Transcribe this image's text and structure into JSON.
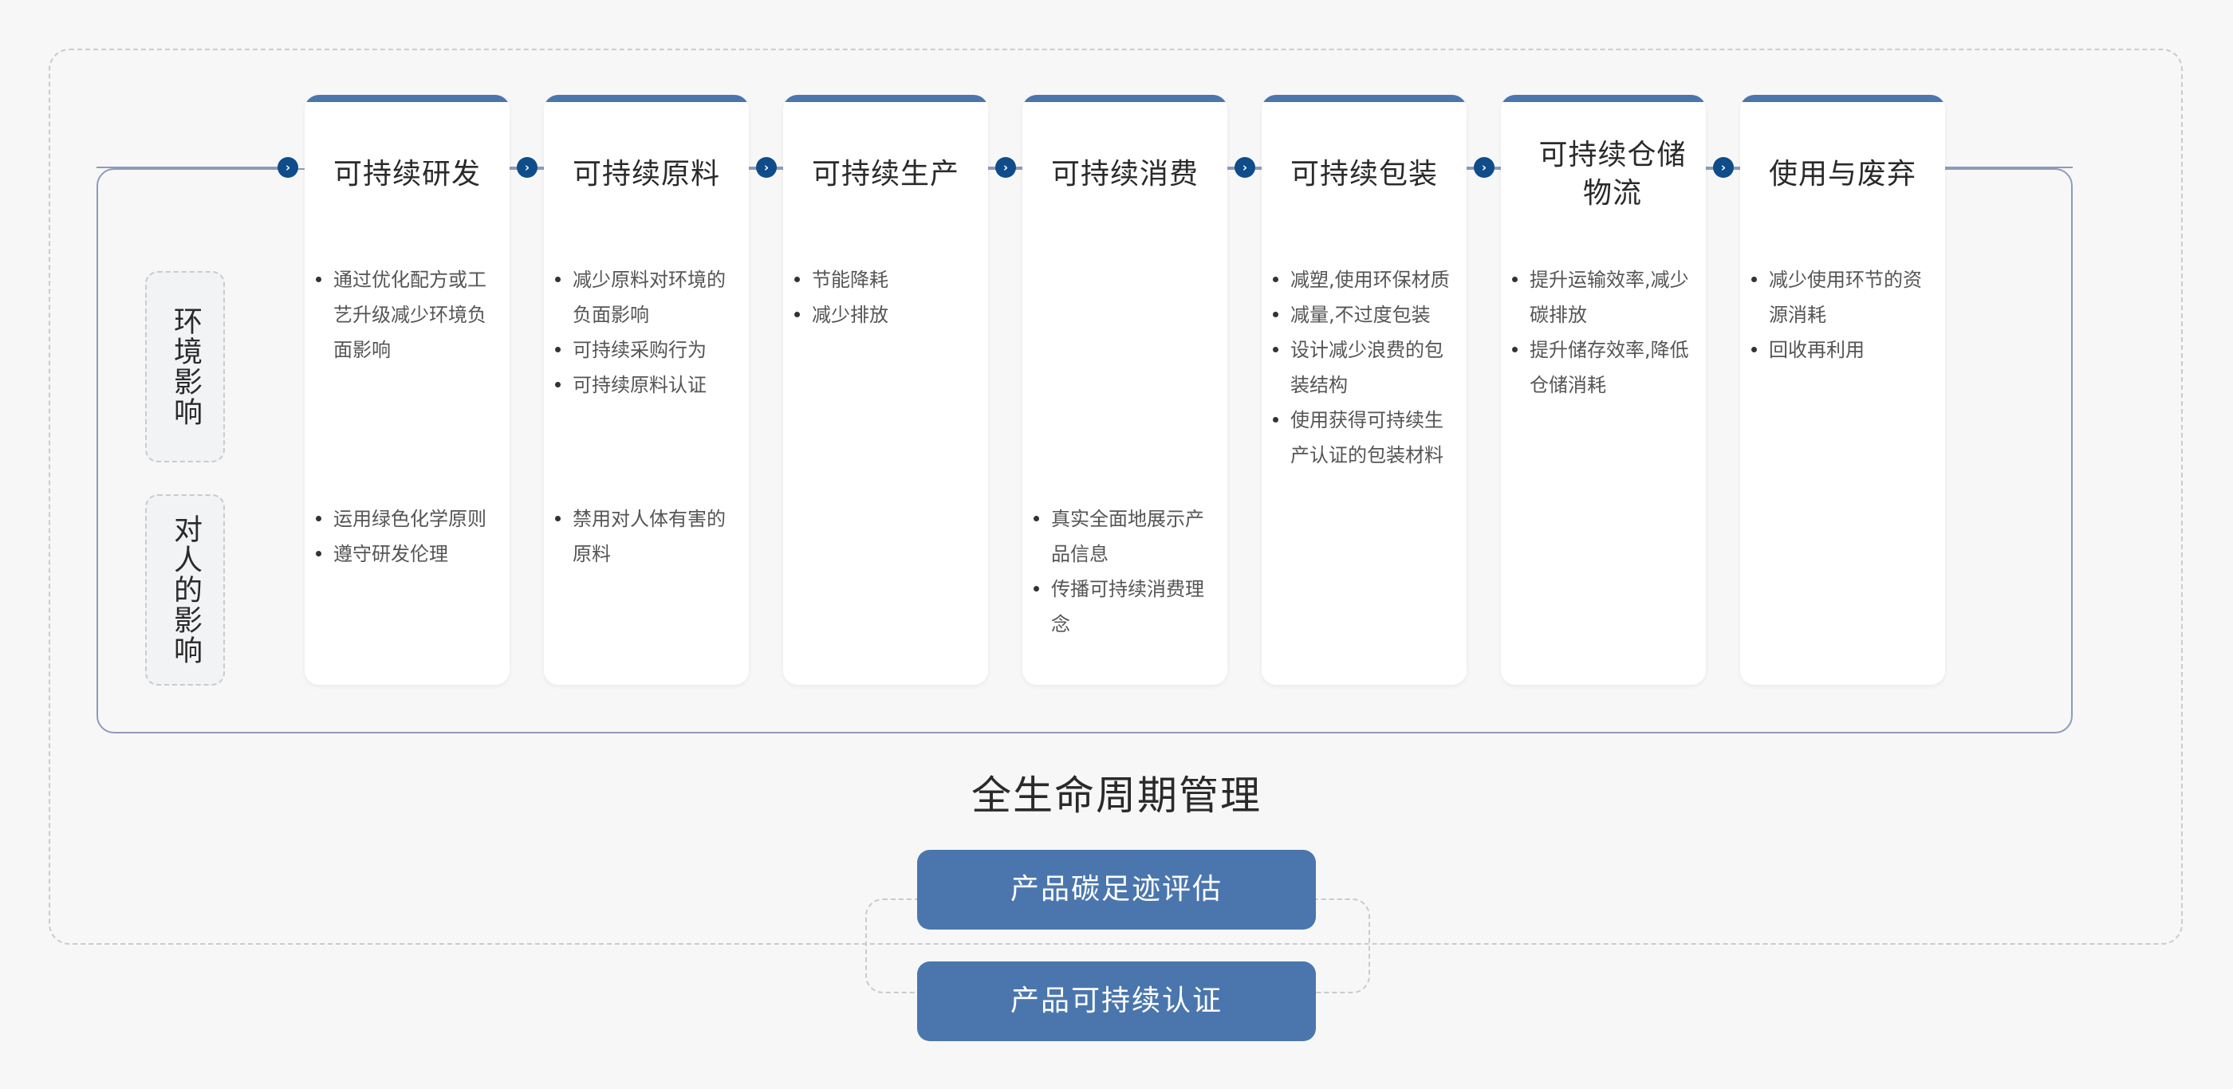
{
  "lifecycle_title": "全生命周期管理",
  "dimensions": {
    "environment": "环境影响",
    "human": "对人的影响"
  },
  "stages": [
    {
      "title": "可持续研发",
      "env": [
        "通过优化配方或工艺升级减少环境负面影响"
      ],
      "human": [
        "运用绿色化学原则",
        "遵守研发伦理"
      ]
    },
    {
      "title": "可持续原料",
      "env": [
        "减少原料对环境的负面影响",
        "可持续采购行为",
        "可持续原料认证"
      ],
      "human": [
        "禁用对人体有害的原料"
      ]
    },
    {
      "title": "可持续生产",
      "env": [
        "节能降耗",
        "减少排放"
      ],
      "human": []
    },
    {
      "title": "可持续消费",
      "env": [],
      "human": [
        "真实全面地展示产品信息",
        "传播可持续消费理念"
      ]
    },
    {
      "title": "可持续包装",
      "env": [
        "减塑,使用环保材质",
        "减量,不过度包装",
        "设计减少浪费的包装结构",
        "使用获得可持续生产认证的包装材料"
      ],
      "human": []
    },
    {
      "title": "可持续仓储物流",
      "env": [
        "提升运输效率,减少碳排放",
        "提升储存效率,降低仓储消耗"
      ],
      "human": []
    },
    {
      "title": "使用与废弃",
      "env": [
        "减少使用环节的资源消耗",
        "回收再利用"
      ],
      "human": []
    }
  ],
  "actions": [
    {
      "label": "产品碳足迹评估"
    },
    {
      "label": "产品可持续认证"
    }
  ],
  "colors": {
    "accent": "#4a76ad",
    "arrow": "#0f4c8a",
    "frame": "#8d9bba"
  },
  "icons": {
    "step_arrow": "chevron-right-icon"
  }
}
